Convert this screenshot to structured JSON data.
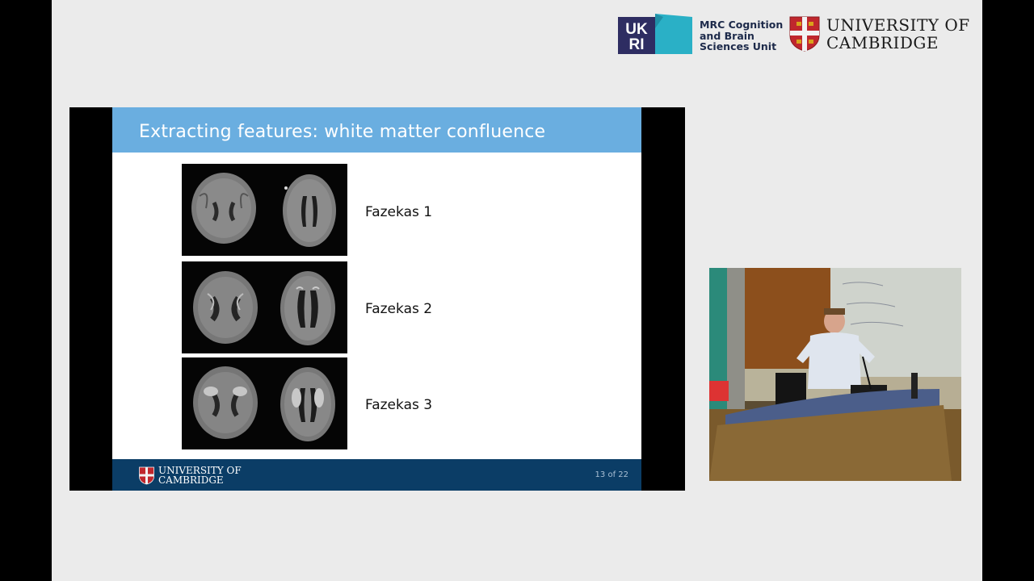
{
  "header": {
    "ukri_logo_text": "UKRI",
    "unit_lines": [
      "MRC Cognition",
      "and Brain",
      "Sciences Unit"
    ],
    "university_lines": [
      "UNIVERSITY OF",
      "CAMBRIDGE"
    ]
  },
  "slide": {
    "title": "Extracting features: white matter confluence",
    "rows": [
      {
        "label": "Fazekas 1"
      },
      {
        "label": "Fazekas 2"
      },
      {
        "label": "Fazekas 3"
      }
    ],
    "footer": {
      "university_lines": [
        "UNIVERSITY OF",
        "CAMBRIDGE"
      ],
      "page_number": "13 of 22"
    }
  },
  "colors": {
    "page_background": "#ebebeb",
    "slide_header": "#6aaee0",
    "slide_footer": "#0b3d66",
    "ukri_navy": "#2e2d62",
    "ukri_teal": "#2ab0c6",
    "cambridge_red": "#c0272d"
  },
  "icons": [
    "ukri-logo",
    "cambridge-crest-icon",
    "brain-mri-scan"
  ]
}
